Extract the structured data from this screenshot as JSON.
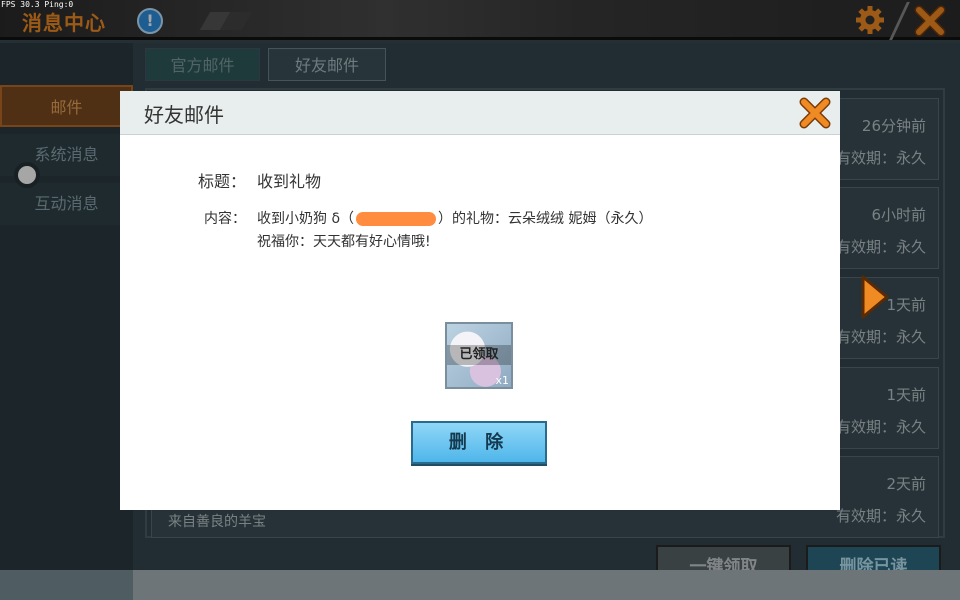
{
  "fps": "FPS 30.3  Ping:0",
  "header": {
    "title": "消息中心",
    "info_icon": "!"
  },
  "sidebar": {
    "items": [
      {
        "label": "邮件"
      },
      {
        "label": "系统消息"
      },
      {
        "label": "互动消息"
      }
    ]
  },
  "tabs": [
    {
      "label": "官方邮件"
    },
    {
      "label": "好友邮件"
    }
  ],
  "mail_list": [
    {
      "time": "26分钟前",
      "valid": "有效期：永久",
      "from": ""
    },
    {
      "time": "6小时前",
      "valid": "有效期：永久",
      "from": ""
    },
    {
      "time": "1天前",
      "valid": "有效期：永久",
      "from": ""
    },
    {
      "time": "1天前",
      "valid": "有效期：永久",
      "from": ""
    },
    {
      "time": "2天前",
      "valid": "有效期：永久",
      "from": "来自善良的羊宝"
    }
  ],
  "footer": {
    "claim_all": "一键领取",
    "delete_read": "删除已读"
  },
  "modal": {
    "title": "好友邮件",
    "subject_label": "标题：",
    "subject": "收到礼物",
    "content_label": "内容：",
    "content_line1_pre": "收到小奶狗 δ（",
    "content_line1_post": "）的礼物：云朵绒绒 妮姆（永久）",
    "content_line2": "祝福你：天天都有好心情哦!",
    "item": {
      "status": "已领取",
      "count": "x1"
    },
    "delete_button": "删 除"
  },
  "colors": {
    "accent": "#f08a22",
    "primary_button": "#4fb6ea"
  }
}
